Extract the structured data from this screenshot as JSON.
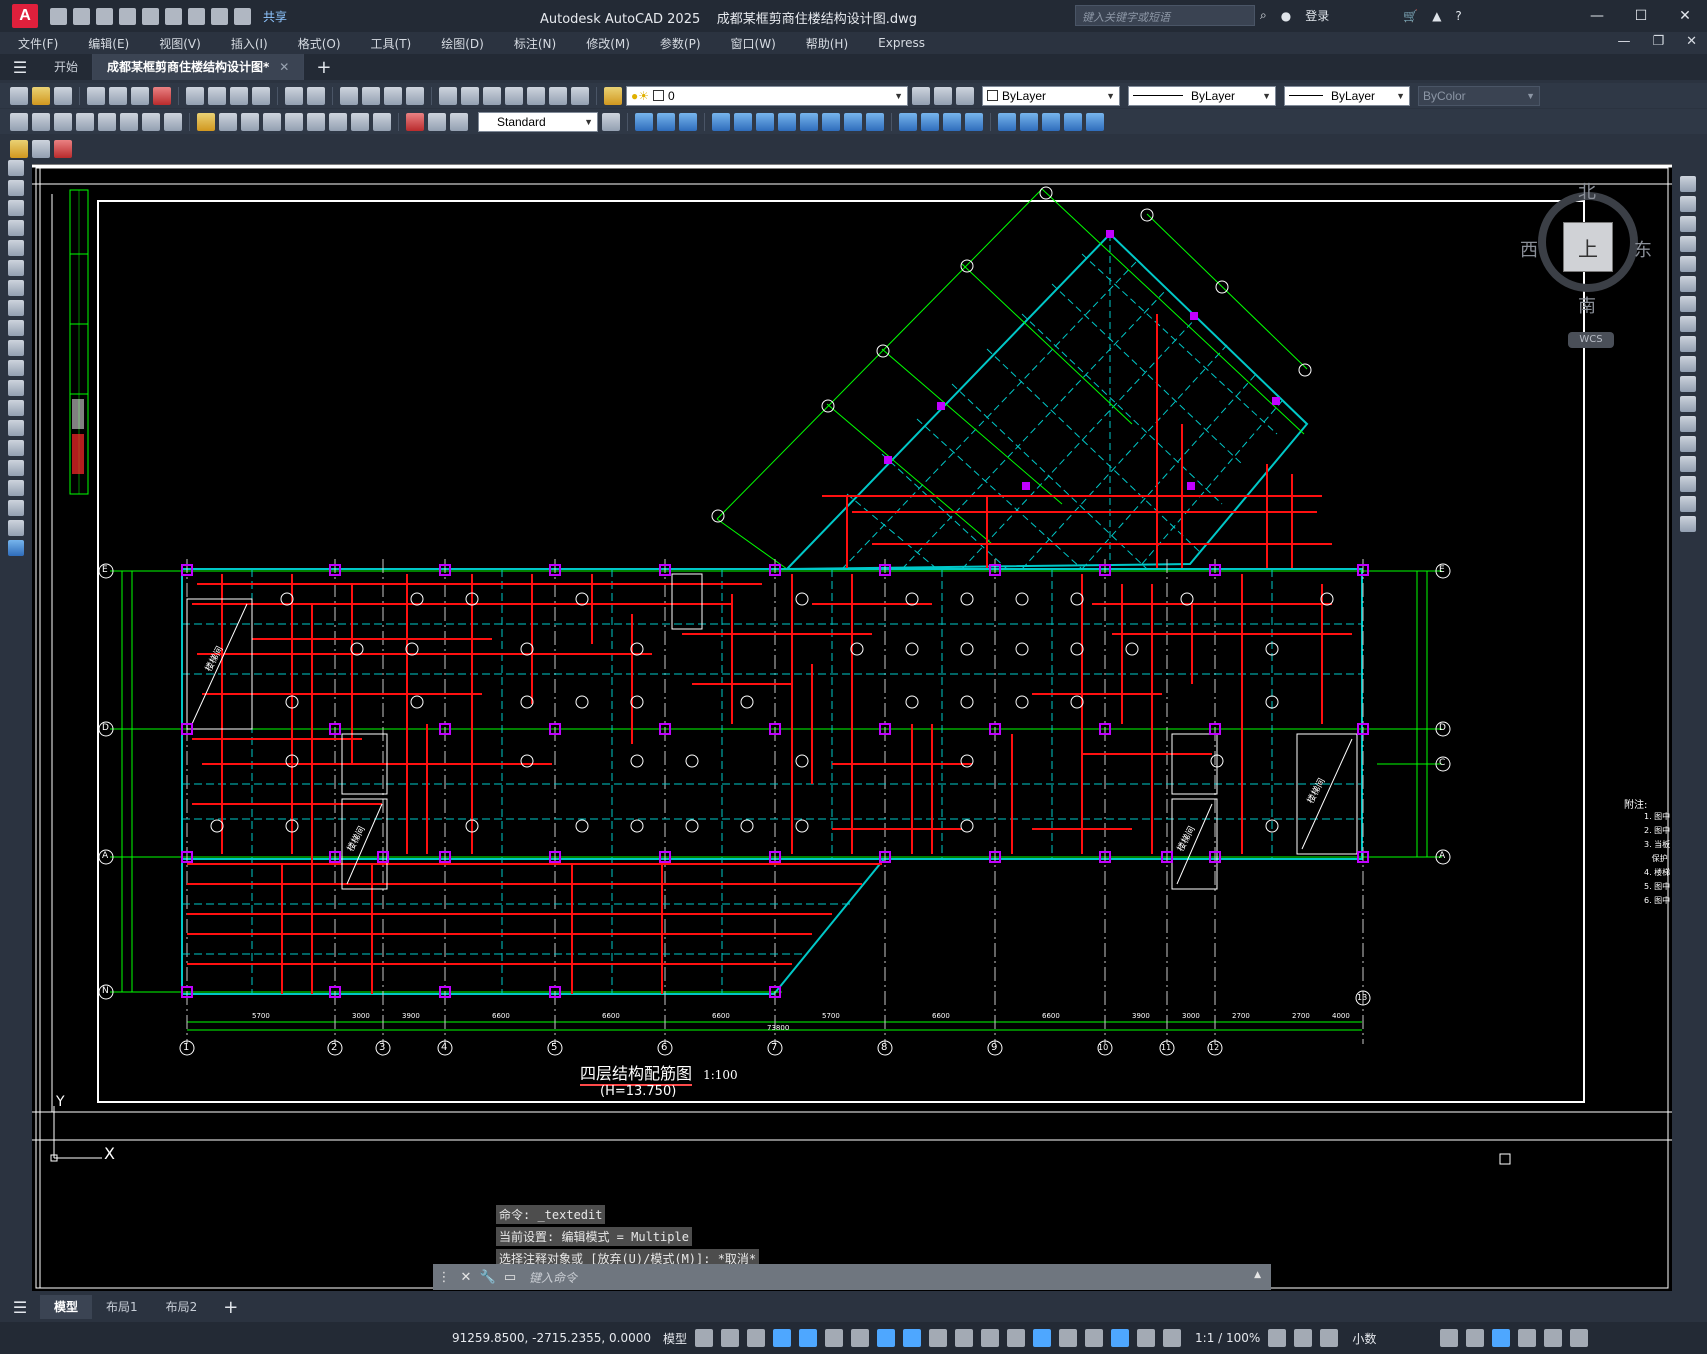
{
  "app": {
    "title": "Autodesk AutoCAD 2025",
    "filename": "成都某框剪商住楼结构设计图.dwg",
    "logo": "A",
    "share": "共享",
    "search_placeholder": "键入关键字或短语",
    "login": "登录"
  },
  "menu": [
    "文件(F)",
    "编辑(E)",
    "视图(V)",
    "插入(I)",
    "格式(O)",
    "工具(T)",
    "绘图(D)",
    "标注(N)",
    "修改(M)",
    "参数(P)",
    "窗口(W)",
    "帮助(H)",
    "Express"
  ],
  "tabs": {
    "start": "开始",
    "doc": "成都某框剪商住楼结构设计图*"
  },
  "toolbar": {
    "layer_value": "0",
    "color_value": "ByLayer",
    "linetype_value": "ByLayer",
    "lineweight_value": "ByLayer",
    "plotstyle_value": "ByColor",
    "textstyle_value": "Standard"
  },
  "viewcube": {
    "north": "北",
    "south": "南",
    "east": "东",
    "west": "西",
    "face": "上",
    "wcs": "WCS"
  },
  "drawing": {
    "title": "四层结构配筋图",
    "scale": "1:100",
    "elevation": "(H=13.750)",
    "note_header": "附注:",
    "ucs_x": "X",
    "ucs_y": "Y",
    "axis_numbers": [
      "1",
      "2",
      "3",
      "4",
      "5",
      "6",
      "7",
      "8",
      "9",
      "10",
      "11",
      "12",
      "13"
    ],
    "axis_letters_left": [
      "E",
      "D",
      "A",
      "N"
    ],
    "axis_letters_right": [
      "E",
      "D",
      "C",
      "A"
    ],
    "stair_label": "楼梯间"
  },
  "command": {
    "history": [
      "命令: _textedit",
      "当前设置: 编辑模式 = Multiple",
      "选择注释对象或 [放弃(U)/模式(M)]: *取消*"
    ],
    "placeholder": "键入命令"
  },
  "layouts": [
    "模型",
    "布局1",
    "布局2"
  ],
  "status": {
    "coords": "91259.8500, -2715.2355, 0.0000",
    "model": "模型",
    "scale": "1:1 / 100%",
    "units": "小数"
  },
  "colors": {
    "canvas_bg": "#000000",
    "grid_green": "#00ff00",
    "beam_cyan": "#00c8c8",
    "rebar_red": "#ff1010",
    "column_magenta": "#c000ff"
  }
}
